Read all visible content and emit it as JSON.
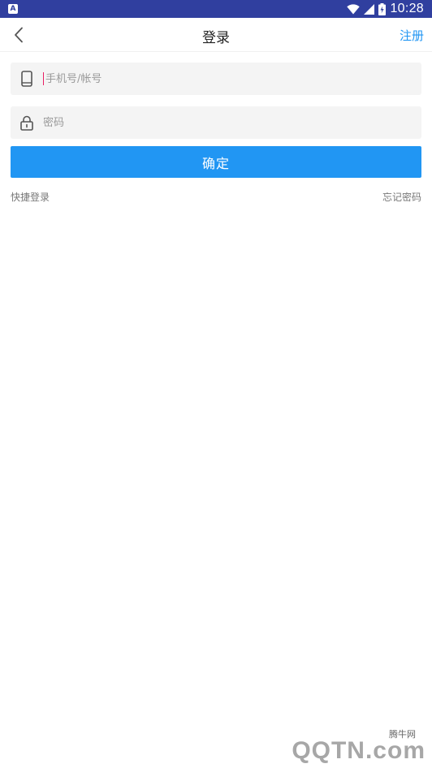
{
  "status_bar": {
    "notification_icon": "A",
    "time": "10:28",
    "icons": [
      "wifi-icon",
      "signal-icon",
      "battery-icon"
    ]
  },
  "nav": {
    "title": "登录",
    "register_label": "注册",
    "back_icon": "chevron-left-icon"
  },
  "form": {
    "phone_placeholder": "手机号/帐号",
    "phone_value": "",
    "password_placeholder": "密码",
    "password_value": "",
    "confirm_label": "确定"
  },
  "links": {
    "quick_login": "快捷登录",
    "forgot_password": "忘记密码"
  },
  "watermark": {
    "small_text": "腾牛网",
    "big_text": "QQTN.com"
  },
  "colors": {
    "status_bar": "#303f9f",
    "accent": "#2196f3",
    "field_bg": "#f4f4f4",
    "caret": "#e91e63"
  }
}
